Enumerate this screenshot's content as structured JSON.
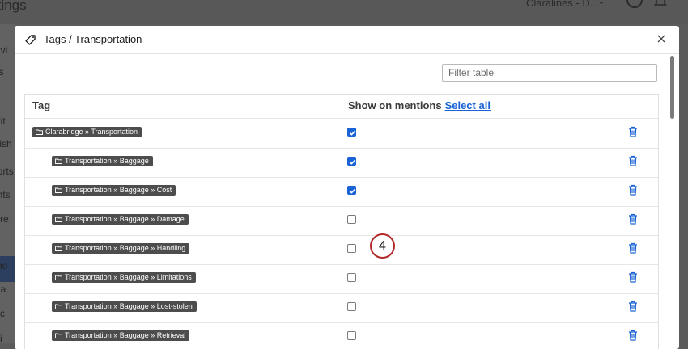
{
  "background": {
    "app_title": "ttings",
    "user_menu": "Claralines - D...",
    "sidebar_fragments": [
      "ervi",
      "ics",
      "rs",
      "urit",
      "olish",
      "ports",
      "ghts",
      "fere",
      "s",
      "cho",
      "gra",
      "tac",
      "mi"
    ]
  },
  "modal": {
    "title": "Tags / Transportation",
    "icon": "tag-icon",
    "filter_placeholder": "Filter table",
    "columns": {
      "tag": "Tag",
      "show_on_mentions": "Show on mentions",
      "select_all": "Select all"
    },
    "rows": [
      {
        "label": "Clarabridge » Transportation",
        "checked": true
      },
      {
        "label": "Transportation » Baggage",
        "checked": true
      },
      {
        "label": "Transportation » Baggage » Cost",
        "checked": true
      },
      {
        "label": "Transportation » Baggage » Damage",
        "checked": false
      },
      {
        "label": "Transportation » Baggage » Handling",
        "checked": false
      },
      {
        "label": "Transportation » Baggage » Limitations",
        "checked": false
      },
      {
        "label": "Transportation » Baggage » Lost-stolen",
        "checked": false
      },
      {
        "label": "Transportation » Baggage » Retrieval",
        "checked": false
      }
    ]
  },
  "callout": {
    "number": "4"
  },
  "colors": {
    "accent": "#1a63d6",
    "pill": "#4d4d4d",
    "callout_border": "#b22a2a"
  }
}
